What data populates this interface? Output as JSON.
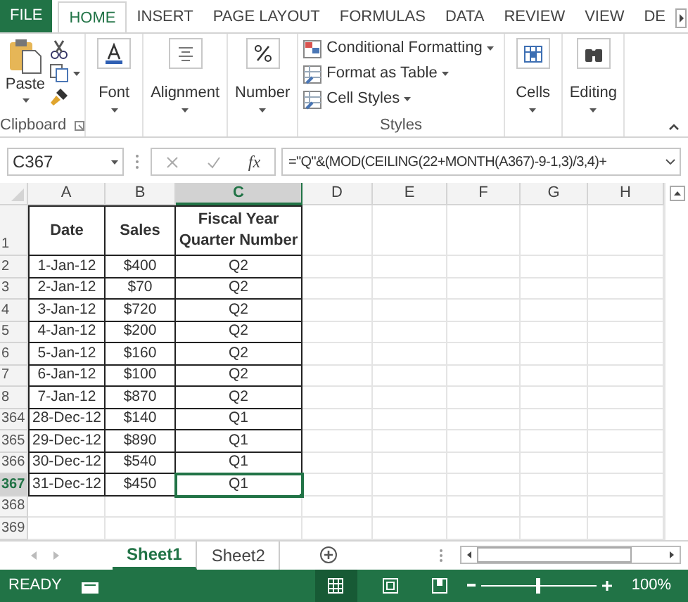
{
  "tabs": [
    {
      "label": "FILE",
      "kind": "file",
      "selected": false
    },
    {
      "label": "HOME",
      "kind": "tab",
      "selected": true
    },
    {
      "label": "INSERT",
      "kind": "tab",
      "selected": false
    },
    {
      "label": "PAGE LAYOUT",
      "kind": "tab",
      "selected": false
    },
    {
      "label": "FORMULAS",
      "kind": "tab",
      "selected": false
    },
    {
      "label": "DATA",
      "kind": "tab",
      "selected": false
    },
    {
      "label": "REVIEW",
      "kind": "tab",
      "selected": false
    },
    {
      "label": "VIEW",
      "kind": "tab",
      "selected": false
    },
    {
      "label": "DE",
      "kind": "tab",
      "selected": false
    }
  ],
  "ribbon": [
    {
      "kind": "clipboard",
      "button": "Paste",
      "label": "Clipboard"
    },
    {
      "kind": "big",
      "button": "Font"
    },
    {
      "kind": "big",
      "button": "Alignment"
    },
    {
      "kind": "big",
      "button": "Number"
    },
    {
      "kind": "styles",
      "items": [
        "Conditional Formatting",
        "Format as Table",
        "Cell Styles"
      ],
      "label": "Styles"
    },
    {
      "kind": "big",
      "button": "Cells"
    },
    {
      "kind": "big",
      "button": "Editing"
    }
  ],
  "formula_bar": {
    "name_box": "C367",
    "function_label": "fx",
    "formula": "=\"Q\"&(MOD(CEILING(22+MONTH(A367)-9-1,3)/3,4)+"
  },
  "columns": [
    {
      "label": "A",
      "selected": false
    },
    {
      "label": "B",
      "selected": false
    },
    {
      "label": "C",
      "selected": true
    },
    {
      "label": "D",
      "selected": false
    },
    {
      "label": "E",
      "selected": false
    },
    {
      "label": "F",
      "selected": false
    },
    {
      "label": "G",
      "selected": false
    },
    {
      "label": "H",
      "selected": false
    }
  ],
  "rows": [
    {
      "header": "1",
      "kind": "header",
      "selected": false,
      "cells": [
        "Date",
        "Sales",
        "Fiscal Year Quarter Number"
      ]
    },
    {
      "header": "2",
      "kind": "data",
      "selected": false,
      "cells": [
        "1-Jan-12",
        "$400",
        "Q2"
      ]
    },
    {
      "header": "3",
      "kind": "data",
      "selected": false,
      "cells": [
        "2-Jan-12",
        "$70",
        "Q2"
      ]
    },
    {
      "header": "4",
      "kind": "data",
      "selected": false,
      "cells": [
        "3-Jan-12",
        "$720",
        "Q2"
      ]
    },
    {
      "header": "5",
      "kind": "data",
      "selected": false,
      "cells": [
        "4-Jan-12",
        "$200",
        "Q2"
      ]
    },
    {
      "header": "6",
      "kind": "data",
      "selected": false,
      "cells": [
        "5-Jan-12",
        "$160",
        "Q2"
      ]
    },
    {
      "header": "7",
      "kind": "data",
      "selected": false,
      "cells": [
        "6-Jan-12",
        "$100",
        "Q2"
      ]
    },
    {
      "header": "8",
      "kind": "data",
      "selected": false,
      "cells": [
        "7-Jan-12",
        "$870",
        "Q2"
      ]
    },
    {
      "header": "364",
      "kind": "data",
      "selected": false,
      "cells": [
        "28-Dec-12",
        "$140",
        "Q1"
      ]
    },
    {
      "header": "365",
      "kind": "data",
      "selected": false,
      "cells": [
        "29-Dec-12",
        "$890",
        "Q1"
      ]
    },
    {
      "header": "366",
      "kind": "data",
      "selected": false,
      "cells": [
        "30-Dec-12",
        "$540",
        "Q1"
      ]
    },
    {
      "header": "367",
      "kind": "data",
      "selected": true,
      "cells": [
        "31-Dec-12",
        "$450",
        "Q1"
      ]
    },
    {
      "header": "368",
      "kind": "empty",
      "selected": false
    },
    {
      "header": "369",
      "kind": "empty",
      "selected": false
    }
  ],
  "sheet_tabs": [
    {
      "label": "Sheet1",
      "selected": true
    },
    {
      "label": "Sheet2",
      "selected": false
    }
  ],
  "status_bar": {
    "status": "READY",
    "zoom": "100%",
    "zoom_level": {
      "level": 0.5
    }
  }
}
